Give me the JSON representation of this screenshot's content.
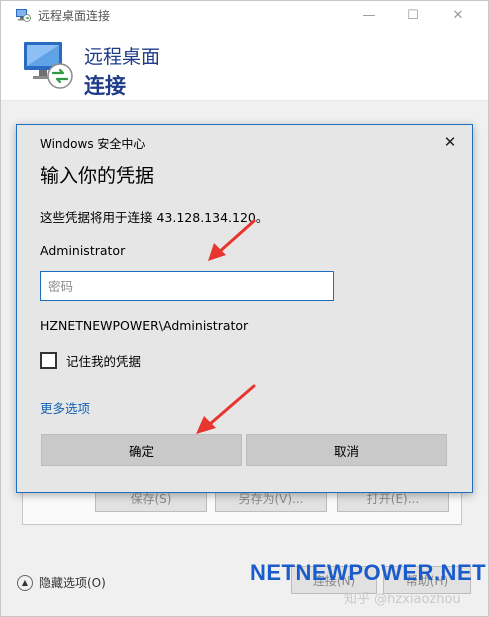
{
  "window": {
    "title": "远程桌面连接",
    "minimize_glyph": "—",
    "maximize_glyph": "☐",
    "close_glyph": "✕"
  },
  "header": {
    "line1": "远程桌面",
    "line2": "连接"
  },
  "background": {
    "save_label": "保存(S)",
    "save_as_label": "另存为(V)...",
    "open_label": "打开(E)...",
    "hide_options_label": "隐藏选项(O)",
    "connect_label": "连接(N)",
    "help_label": "帮助(H)"
  },
  "dialog": {
    "title": "Windows 安全中心",
    "heading": "输入你的凭据",
    "description": "这些凭据将用于连接 43.128.134.120。",
    "username": "Administrator",
    "password_placeholder": "密码",
    "password_value": "",
    "domain_user": "HZNETNEWPOWER\\Administrator",
    "remember_label": "记住我的凭据",
    "remember_checked": false,
    "more_options_label": "更多选项",
    "ok_label": "确定",
    "cancel_label": "取消",
    "close_glyph": "✕"
  },
  "watermark": {
    "brand": "NETNEWPOWER.NET",
    "zhihu": "知乎 @hzxiaozhou"
  },
  "colors": {
    "accent": "#1f6fbe",
    "link": "#1463b5",
    "annotation_arrow": "#e8352e",
    "brand": "#1a5cc9"
  }
}
